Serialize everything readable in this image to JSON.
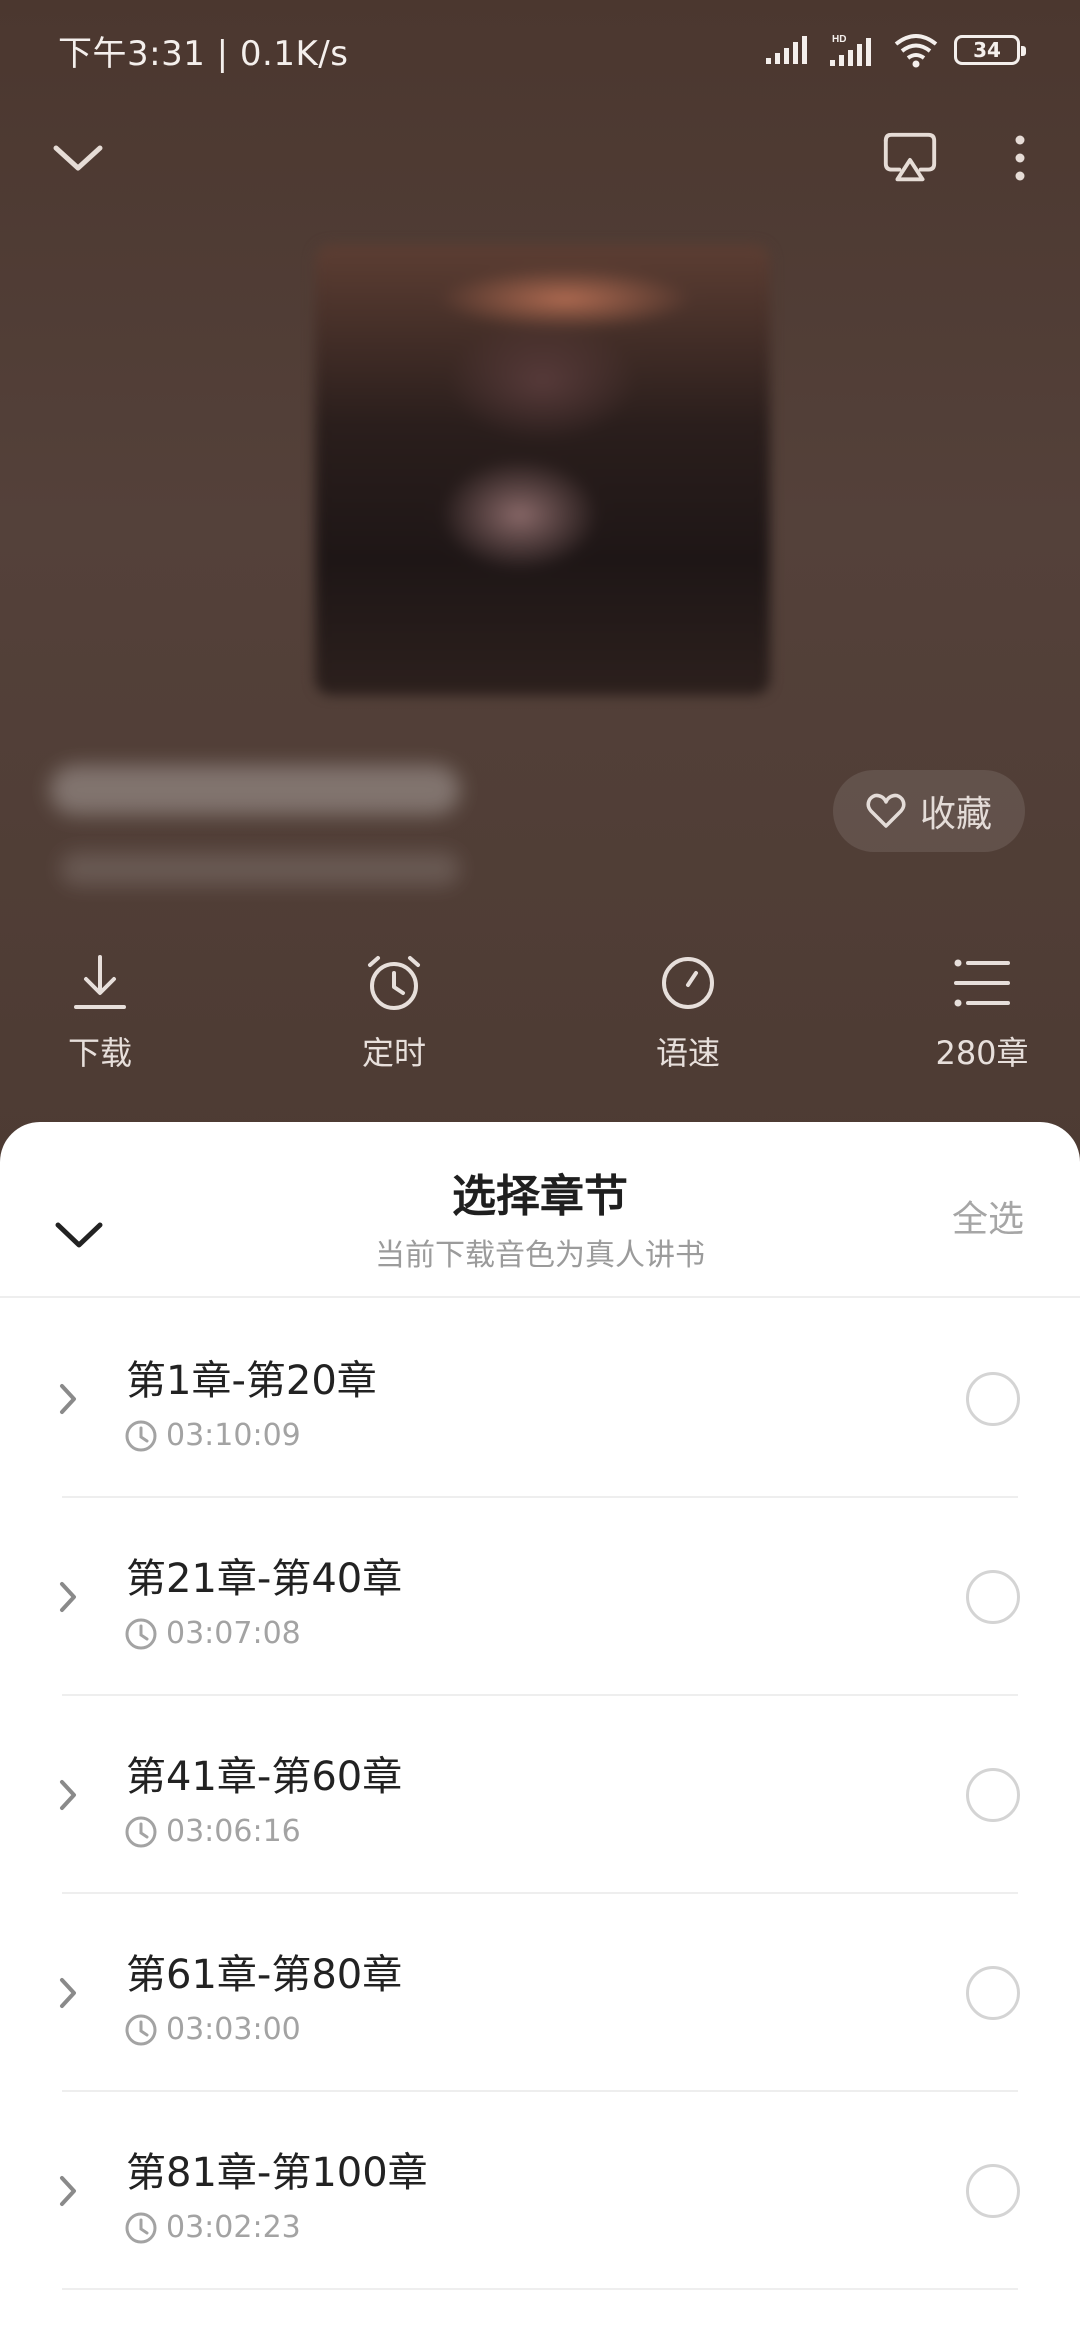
{
  "status_bar": {
    "time": "下午3:31 | 0.1K/s",
    "battery": "34",
    "icons": [
      "signal-icon",
      "hd-signal-icon",
      "wifi-icon",
      "battery-icon"
    ]
  },
  "player": {
    "favorite_label": "收藏",
    "actions": [
      {
        "label": "下载",
        "icon": "download-icon"
      },
      {
        "label": "定时",
        "icon": "alarm-icon"
      },
      {
        "label": "语速",
        "icon": "speed-icon"
      },
      {
        "label": "280章",
        "icon": "list-icon"
      }
    ]
  },
  "sheet": {
    "title": "选择章节",
    "subtitle": "当前下载音色为真人讲书",
    "select_all": "全选",
    "chapters": [
      {
        "title": "第1章-第20章",
        "duration": "03:10:09"
      },
      {
        "title": "第21章-第40章",
        "duration": "03:07:08"
      },
      {
        "title": "第41章-第60章",
        "duration": "03:06:16"
      },
      {
        "title": "第61章-第80章",
        "duration": "03:03:00"
      },
      {
        "title": "第81章-第100章",
        "duration": "03:02:23"
      }
    ]
  },
  "colors": {
    "background": "#4b372f",
    "sheet": "#ffffff",
    "muted_text": "#a3a3a3"
  }
}
